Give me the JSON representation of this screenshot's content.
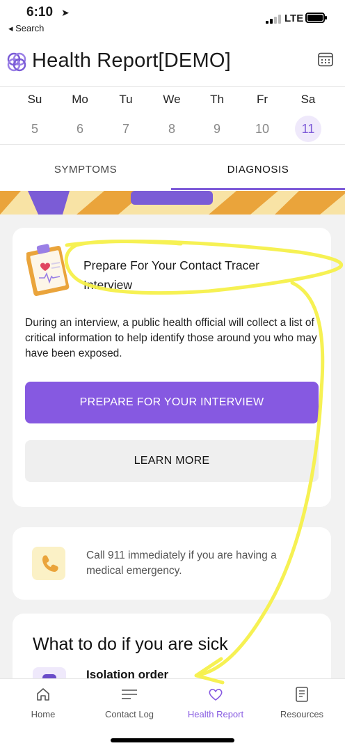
{
  "status_bar": {
    "time": "6:10",
    "back_label": "◂ Search",
    "network": "LTE"
  },
  "header": {
    "title": "Health Report[DEMO]"
  },
  "week": {
    "days": [
      {
        "name": "Su",
        "date": "5"
      },
      {
        "name": "Mo",
        "date": "6"
      },
      {
        "name": "Tu",
        "date": "7"
      },
      {
        "name": "We",
        "date": "8"
      },
      {
        "name": "Th",
        "date": "9"
      },
      {
        "name": "Fr",
        "date": "10"
      },
      {
        "name": "Sa",
        "date": "11"
      }
    ],
    "selected": "11"
  },
  "tabs": [
    {
      "label": "SYMPTOMS"
    },
    {
      "label": "DIAGNOSIS",
      "active": true
    }
  ],
  "contact_tracer_card": {
    "title": "Prepare For Your Contact Tracer Interview",
    "body": "During an interview, a public health official will collect a list of critical information to help identify those around you who may have been exposed.",
    "primary_button": "PREPARE FOR YOUR INTERVIEW",
    "secondary_button": "LEARN MORE"
  },
  "emergency_card": {
    "text": "Call 911 immediately if you are having a medical emergency."
  },
  "sick_card": {
    "title": "What to do if you are sick",
    "item_label": "Isolation order"
  },
  "bottom_nav": [
    {
      "label": "Home",
      "icon": "home-icon"
    },
    {
      "label": "Contact Log",
      "icon": "list-icon"
    },
    {
      "label": "Health Report",
      "icon": "heart-icon",
      "active": true
    },
    {
      "label": "Resources",
      "icon": "document-icon"
    }
  ],
  "colors": {
    "accent": "#8659e1",
    "accent_light": "#efe9fb",
    "banner_yellow": "#f8e3a5",
    "banner_orange": "#eaa43b",
    "annotation_yellow": "#f5f04a"
  }
}
